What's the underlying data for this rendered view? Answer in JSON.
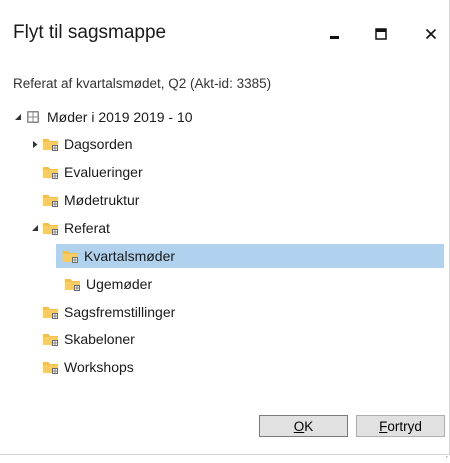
{
  "window": {
    "title": "Flyt til sagsmappe",
    "subtitle": "Referat af kvartalsmødet, Q2 (Akt-id: 3385)"
  },
  "titlebar_buttons": [
    {
      "name": "minimize",
      "icon": "minimize-icon"
    },
    {
      "name": "maximize",
      "icon": "maximize-icon"
    },
    {
      "name": "close",
      "icon": "close-icon"
    }
  ],
  "tree": {
    "root": {
      "label": "Møder i 2019 2019 - 10",
      "expanded": true,
      "icon": "case-folder-icon"
    },
    "items": [
      {
        "label": "Dagsorden",
        "level": 1,
        "expander": "collapsed"
      },
      {
        "label": "Evalueringer",
        "level": 1,
        "expander": "none"
      },
      {
        "label": "Mødetruktur",
        "level": 1,
        "expander": "none"
      },
      {
        "label": "Referat",
        "level": 1,
        "expander": "expanded"
      },
      {
        "label": "Kvartalsmøder",
        "level": 2,
        "expander": "none",
        "selected": true
      },
      {
        "label": "Ugemøder",
        "level": 2,
        "expander": "none"
      },
      {
        "label": "Sagsfremstillinger",
        "level": 1,
        "expander": "none"
      },
      {
        "label": "Skabeloner",
        "level": 1,
        "expander": "none"
      },
      {
        "label": "Workshops",
        "level": 1,
        "expander": "none"
      }
    ]
  },
  "buttons": {
    "ok_prefix": "",
    "ok_mnemonic": "O",
    "ok_rest": "K",
    "cancel_mnemonic": "F",
    "cancel_rest": "ortryd"
  },
  "colors": {
    "selection": "#b1d2ef",
    "folder": "#f4c04a",
    "folder_dark": "#d9a12c",
    "folder_badge": "#6b6b6b"
  }
}
